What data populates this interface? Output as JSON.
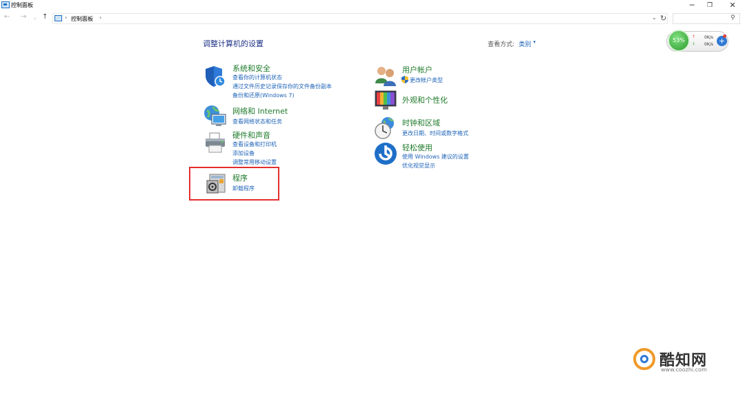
{
  "window": {
    "title": "控制面板",
    "minimize": "─",
    "maximize": "❐",
    "close": "✕"
  },
  "nav": {
    "back": "←",
    "forward": "→",
    "history": "⌄",
    "up": "↑"
  },
  "address": {
    "sep1": "›",
    "crumb": "控制面板",
    "sep2": "›",
    "dropdown": "⌄",
    "refresh": "↻"
  },
  "search": {
    "icon": "⚲",
    "placeholder": ""
  },
  "page": {
    "title": "调整计算机的设置",
    "view_label": "查看方式:",
    "view_value": "类别",
    "view_caret": "▾"
  },
  "left_categories": [
    {
      "title": "系统和安全",
      "icon": "shield-icon",
      "links": [
        "查看你的计算机状态",
        "通过文件历史记录保存你的文件备份副本",
        "备份和还原(Windows 7)"
      ]
    },
    {
      "title": "网络和 Internet",
      "icon": "network-icon",
      "links": [
        "查看网络状态和任务"
      ]
    },
    {
      "title": "硬件和声音",
      "icon": "printer-icon",
      "links": [
        "查看设备和打印机",
        "添加设备",
        "调整常用移动设置"
      ]
    },
    {
      "title": "程序",
      "icon": "programs-icon",
      "links": [
        "卸载程序"
      ]
    }
  ],
  "right_categories": [
    {
      "title": "用户帐户",
      "icon": "users-icon",
      "links": [
        "更改帐户类型"
      ]
    },
    {
      "title": "外观和个性化",
      "icon": "appearance-icon",
      "links": []
    },
    {
      "title": "时钟和区域",
      "icon": "clock-icon",
      "links": [
        "更改日期、时间或数字格式"
      ]
    },
    {
      "title": "轻松使用",
      "icon": "ease-of-access-icon",
      "links": [
        "使用 Windows 建议的设置",
        "优化视觉显示"
      ]
    }
  ],
  "net_widget": {
    "cpu": "53%",
    "up_arrow": "↑",
    "down_arrow": "↓",
    "up_speed": "0K/s",
    "down_speed": "0K/s",
    "add": "+"
  },
  "watermark": {
    "text": "酷知网",
    "url": "www.coozhi.com"
  }
}
